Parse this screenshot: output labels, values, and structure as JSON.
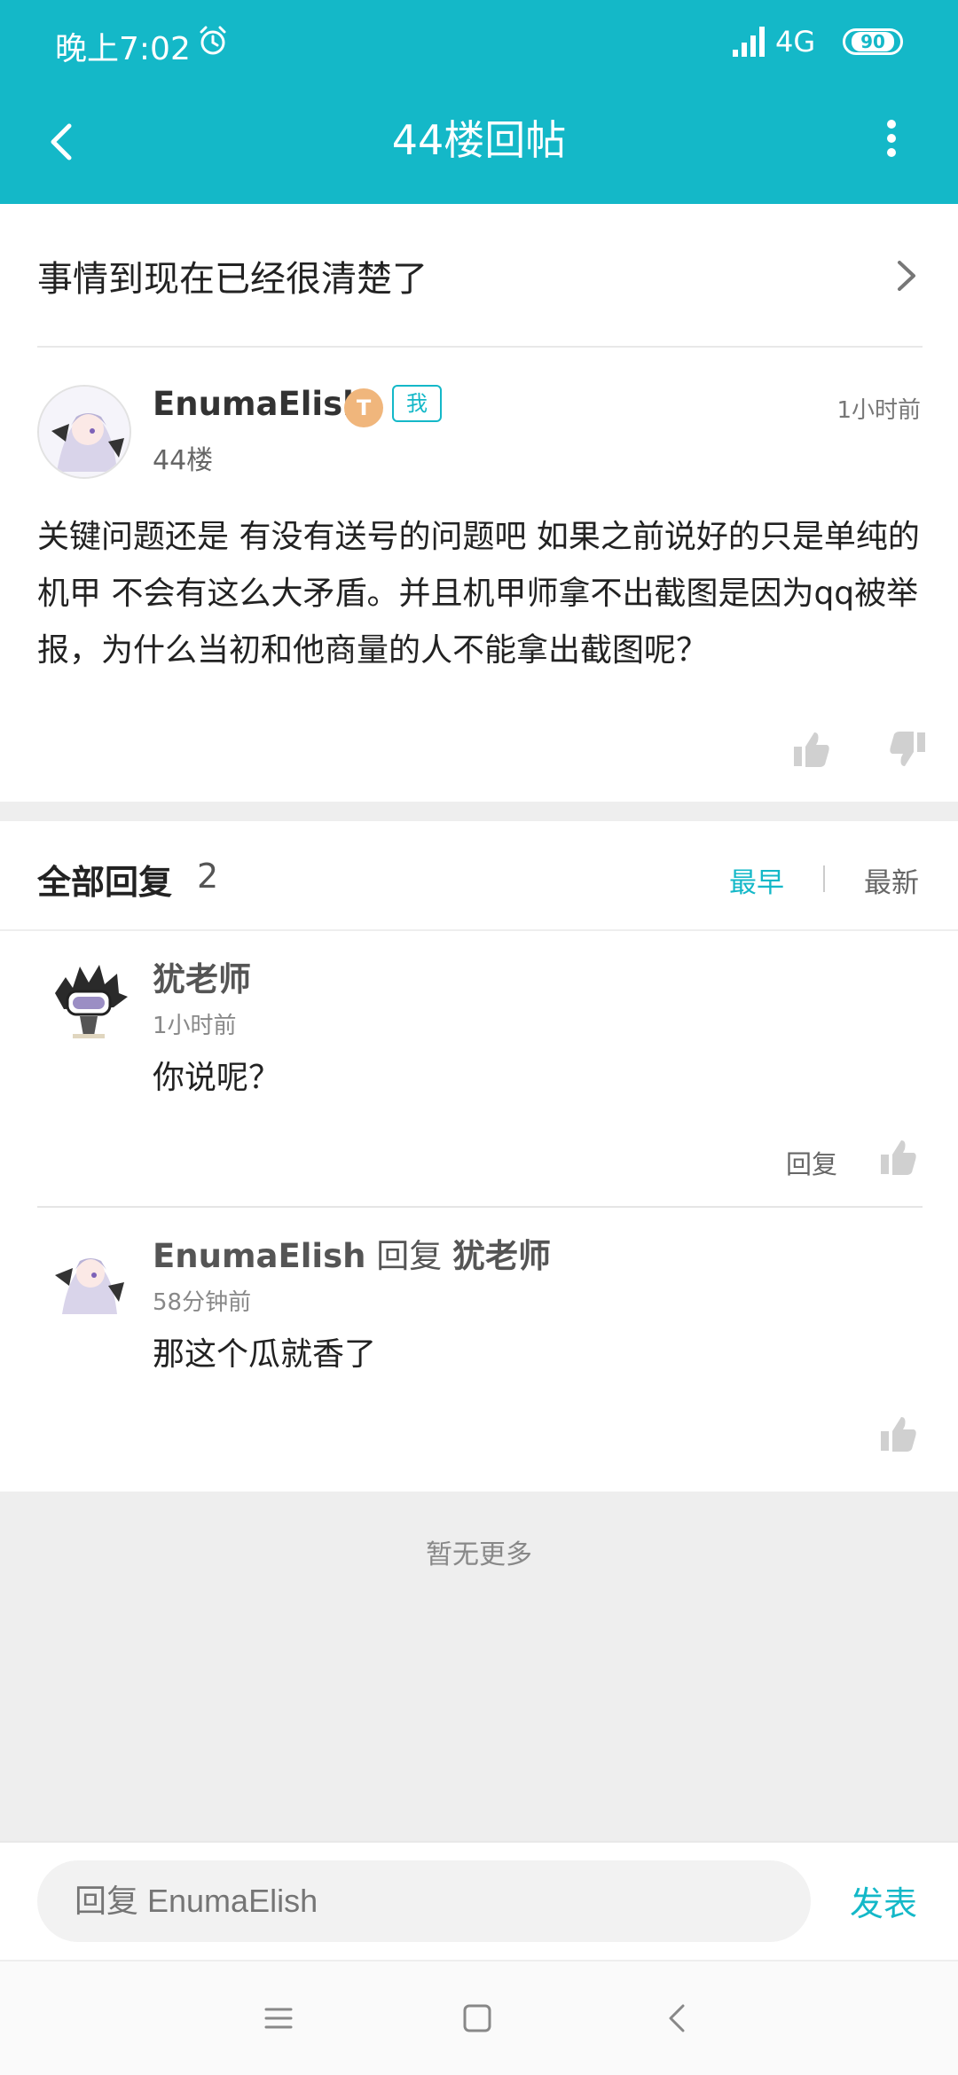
{
  "status_bar": {
    "time": "晚上7:02",
    "network": "4G",
    "battery": "90",
    "icons": [
      "alarm-icon",
      "signal-icon",
      "battery-icon"
    ]
  },
  "header": {
    "title": "44楼回帖",
    "back_icon": "back-arrow-icon",
    "more_icon": "more-vertical-icon"
  },
  "thread": {
    "subject": "事情到现在已经很清楚了"
  },
  "post": {
    "author": "EnumaElish",
    "level_badge": "T",
    "me_badge": "我",
    "time": "1小时前",
    "floor": "44楼",
    "content": "关键问题还是 有没有送号的问题吧 如果之前说好的只是单纯的机甲 不会有这么大矛盾。并且机甲师拿不出截图是因为qq被举报，为什么当初和他商量的人不能拿出截图呢？"
  },
  "replies_header": {
    "label": "全部回复",
    "count": "2",
    "sort_earliest": "最早",
    "sort_latest": "最新"
  },
  "replies": [
    {
      "author": "犹老师",
      "reply_to_label": "",
      "reply_to": "",
      "time": "1小时前",
      "text": "你说呢？",
      "reply_button": "回复"
    },
    {
      "author": "EnumaElish",
      "reply_to_label": "回复",
      "reply_to": "犹老师",
      "time": "58分钟前",
      "text": "那这个瓜就香了",
      "reply_button": ""
    }
  ],
  "empty_message": "暂无更多",
  "composer": {
    "placeholder": "回复 EnumaElish",
    "send_label": "发表"
  },
  "colors": {
    "accent": "#14b8c8",
    "badge_level": "#f0b67c"
  }
}
